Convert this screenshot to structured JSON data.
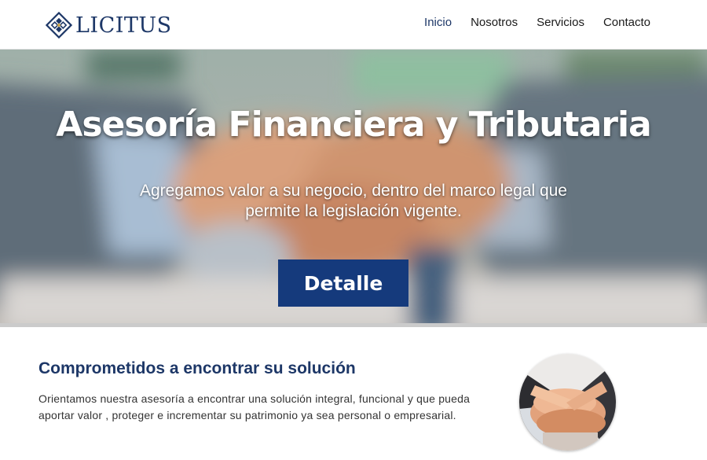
{
  "header": {
    "logo_text": "LICITUS",
    "nav": [
      {
        "label": "Inicio",
        "active": true
      },
      {
        "label": "Nosotros",
        "active": false
      },
      {
        "label": "Servicios",
        "active": false
      },
      {
        "label": "Contacto",
        "active": false
      }
    ]
  },
  "hero": {
    "title": "Asesoría Financiera y Tributaria",
    "subtitle": "Agregamos valor a su negocio, dentro del marco legal que permite la legislación vigente.",
    "button_label": "Detalle",
    "image_icon": "handshake-image"
  },
  "section": {
    "title": "Comprometidos a encontrar su solución",
    "text": "Orientamos nuestra asesoría a encontrar una solución integral, funcional y que pueda aportar valor , proteger e incrementar su patrimonio ya sea personal o empresarial.",
    "image_icon": "team-hands-image"
  },
  "colors": {
    "brand": "#1d3767",
    "button": "#153a7c",
    "logo_gold": "#c9a34a"
  }
}
